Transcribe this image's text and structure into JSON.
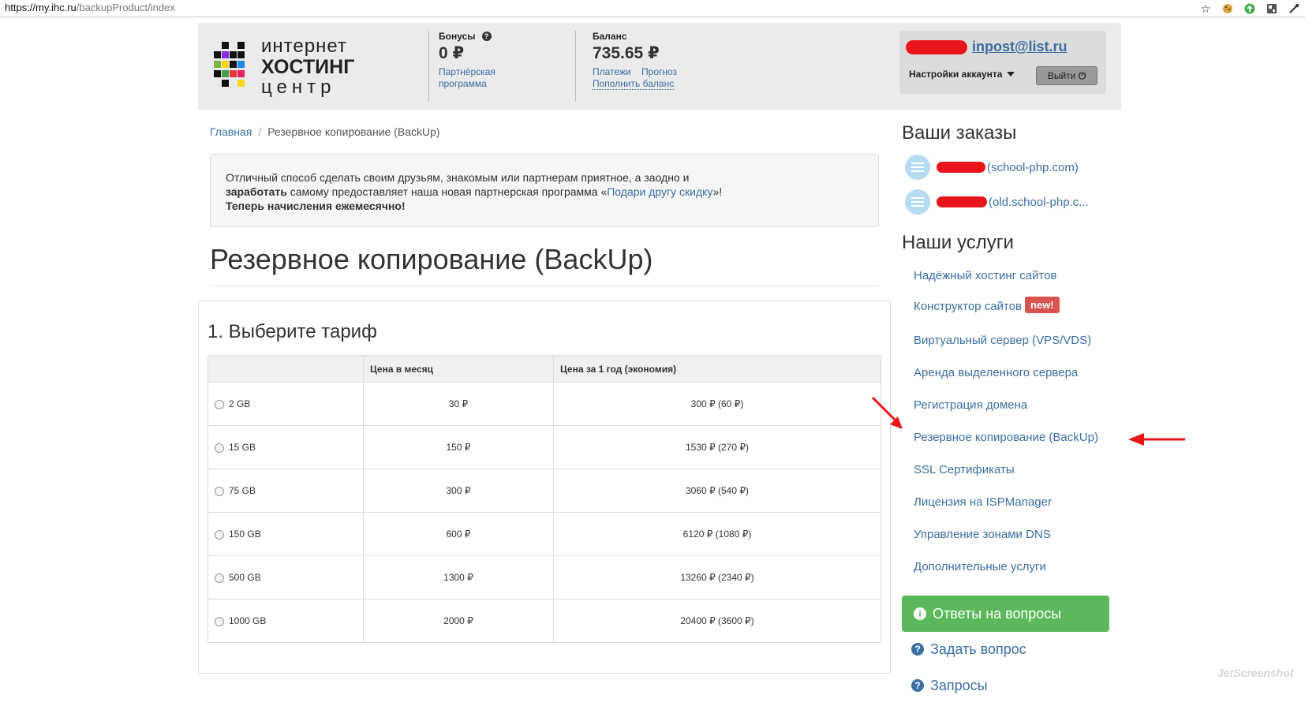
{
  "browser": {
    "url_host": "https://my.ihc.ru",
    "url_path": "/backupProduct/index",
    "icons": [
      "star-icon",
      "cookie-icon",
      "update-icon",
      "extension-icon",
      "tool-icon"
    ]
  },
  "logo": {
    "line1": "интернет",
    "line2": "ХОСТИНГ",
    "line3": "центр"
  },
  "header": {
    "bonus_label": "Бонусы",
    "bonus_value": "0 ₽",
    "bonus_link1": "Партнёрская",
    "bonus_link2": "программа",
    "balance_label": "Баланс",
    "balance_value": "735.65 ₽",
    "payments_link": "Платежи",
    "forecast_link": "Прогноз",
    "topup_link": "Пополнить баланс"
  },
  "account": {
    "email": "inpost@list.ru",
    "settings_label": "Настройки аккаунта",
    "logout_label": "Выйти"
  },
  "breadcrumb": {
    "home": "Главная",
    "separator": "/",
    "current": "Резервное копирование (BackUp)"
  },
  "promo": {
    "text1": "Отличный способ сделать своим друзьям, знакомым или партнерам приятное, а заодно и",
    "bold1": "заработать",
    "text2": " самому предоставляет наша новая партнерская программа «",
    "link": "Подари другу скидку",
    "text3": "»!",
    "bold2": "Теперь начисления ежемесячно!"
  },
  "page_title": "Резервное копирование (BackUp)",
  "tariff_section": {
    "heading": "1. Выберите тариф",
    "columns": [
      "",
      "Цена в месяц",
      "Цена за 1 год (экономия)"
    ],
    "rows": [
      {
        "size": "2 GB",
        "monthly": "30 ₽",
        "yearly": "300 ₽ (60 ₽)"
      },
      {
        "size": "15 GB",
        "monthly": "150 ₽",
        "yearly": "1530 ₽ (270 ₽)"
      },
      {
        "size": "75 GB",
        "monthly": "300 ₽",
        "yearly": "3060 ₽ (540 ₽)"
      },
      {
        "size": "150 GB",
        "monthly": "600 ₽",
        "yearly": "6120 ₽ (1080 ₽)"
      },
      {
        "size": "500 GB",
        "monthly": "1300 ₽",
        "yearly": "13260 ₽ (2340 ₽)"
      },
      {
        "size": "1000 GB",
        "monthly": "2000 ₽",
        "yearly": "20400 ₽ (3600 ₽)"
      }
    ]
  },
  "orders": {
    "title": "Ваши заказы",
    "items": [
      "(school-php.com)",
      "(old.school-php.c..."
    ]
  },
  "services": {
    "title": "Наши услуги",
    "items": [
      "Надёжный хостинг сайтов",
      "Конструктор сайтов",
      "Виртуальный сервер (VPS/VDS)",
      "Аренда выделенного сервера",
      "Регистрация домена",
      "Резервное копирование (BackUp)",
      "SSL Сертификаты",
      "Лицензия на ISPManager",
      "Управление зонами DNS",
      "Дополнительные услуги"
    ],
    "new_badge": "new!"
  },
  "help": {
    "faq_button": "Ответы на вопросы",
    "ask_link": "Задать вопрос",
    "requests_link": "Запросы",
    "info_glyph": "i",
    "question_glyph": "?"
  },
  "watermark": "JetScreenshot",
  "colors": {
    "link": "#3a6ea5",
    "success": "#5cb85c",
    "danger": "#d9534f",
    "annotation_arrow": "#e8161a"
  }
}
